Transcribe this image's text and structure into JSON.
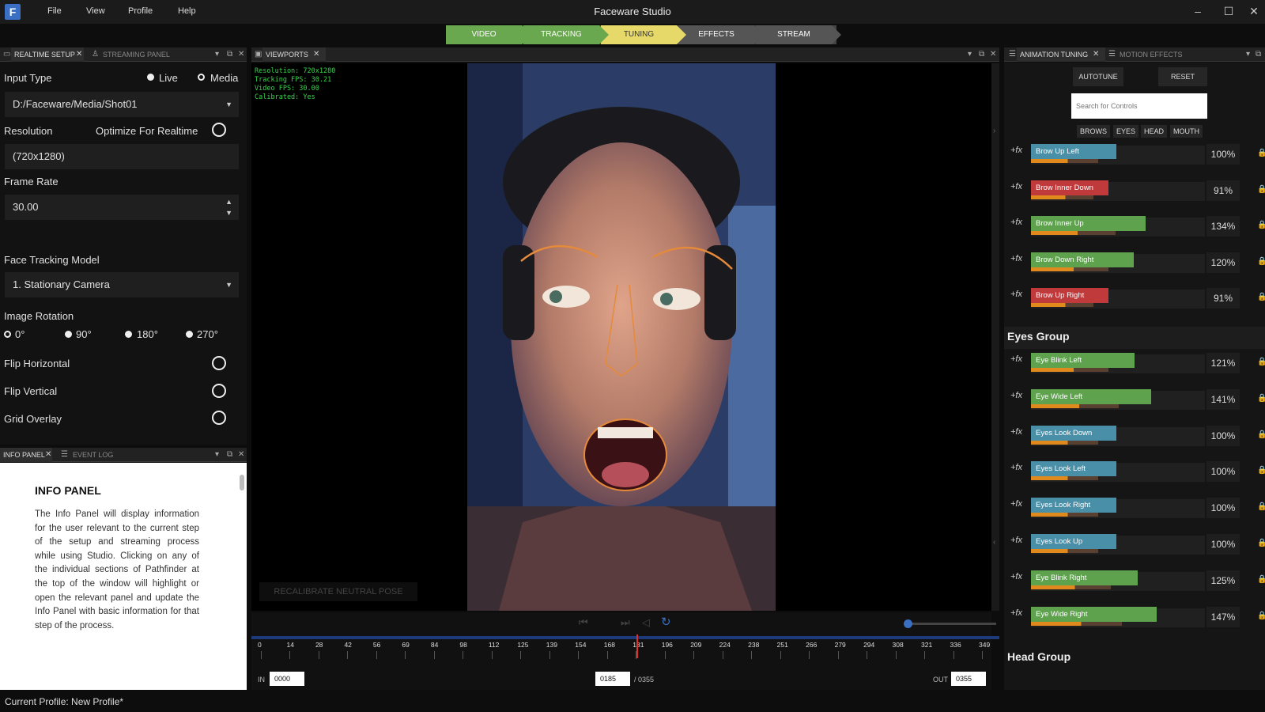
{
  "app": {
    "title": "Faceware Studio"
  },
  "menu": [
    "File",
    "View",
    "Profile",
    "Help"
  ],
  "window_controls": [
    "–",
    "☐",
    "✕"
  ],
  "pipeline": {
    "steps": [
      {
        "label": "VIDEO",
        "color": "#6aa84f"
      },
      {
        "label": "TRACKING",
        "color": "#6aa84f"
      },
      {
        "label": "TUNING",
        "color": "#e6d96a"
      },
      {
        "label": "EFFECTS",
        "color": "#555555"
      },
      {
        "label": "STREAM",
        "color": "#555555"
      }
    ]
  },
  "left_tabs": {
    "active": "REALTIME SETUP",
    "inactive": "STREAMING PANEL"
  },
  "realtime": {
    "input_type_label": "Input Type",
    "live_label": "Live",
    "media_label": "Media",
    "media_path": "D:/Faceware/Media/Shot01",
    "resolution_label": "Resolution",
    "optimize_label": "Optimize For Realtime",
    "resolution_value": "(720x1280)",
    "frame_rate_label": "Frame Rate",
    "frame_rate_value": "30.00",
    "tracking_model_label": "Face Tracking Model",
    "tracking_model_value": "1. Stationary Camera",
    "rotation_label": "Image Rotation",
    "rotations": [
      "0°",
      "90°",
      "180°",
      "270°"
    ],
    "flip_h_label": "Flip Horizontal",
    "flip_v_label": "Flip Vertical",
    "grid_label": "Grid Overlay"
  },
  "info_tabs": {
    "active": "INFO PANEL",
    "inactive": "EVENT LOG"
  },
  "info": {
    "title": "INFO PANEL",
    "body": "The Info Panel will display information for the user relevant to the current step of the setup and streaming process while using Studio. Clicking on any of the individual sections of Pathfinder at the top of the window will highlight or open the relevant panel and update the Info Panel with basic information for that step of the process."
  },
  "viewport": {
    "tab": "VIEWPORTS",
    "stats": [
      "Resolution: 720x1280",
      "Tracking FPS: 30.21",
      "Video FPS: 30.00",
      "Calibrated: Yes"
    ],
    "recalibrate_label": "RECALIBRATE NEUTRAL POSE"
  },
  "timeline": {
    "ticks": [
      "0",
      "14",
      "28",
      "42",
      "56",
      "69",
      "84",
      "98",
      "112",
      "125",
      "139",
      "154",
      "168",
      "181",
      "196",
      "209",
      "224",
      "238",
      "251",
      "266",
      "279",
      "294",
      "308",
      "321",
      "336",
      "349"
    ],
    "in_label": "IN",
    "in_value": "0000",
    "current": "0185",
    "total": "/ 0355",
    "out_label": "OUT",
    "out_value": "0355",
    "playhead_fraction": 0.521
  },
  "right_tabs": {
    "active": "ANIMATION TUNING",
    "inactive": "MOTION EFFECTS"
  },
  "tuning": {
    "autotune_label": "AUTOTUNE",
    "reset_label": "RESET",
    "search_placeholder": "Search for Controls",
    "groups": [
      "BROWS",
      "EYES",
      "HEAD",
      "MOUTH"
    ],
    "fx_label": "+fx",
    "brows": [
      {
        "name": "Brow Up Left",
        "pct": "100%",
        "color": "#4a8fa8"
      },
      {
        "name": "Brow Inner Down",
        "pct": "91%",
        "color": "#c0393b"
      },
      {
        "name": "Brow Inner Up",
        "pct": "134%",
        "color": "#5ea24e"
      },
      {
        "name": "Brow Down Right",
        "pct": "120%",
        "color": "#5ea24e"
      },
      {
        "name": "Brow Up Right",
        "pct": "91%",
        "color": "#c0393b"
      }
    ],
    "eyes_title": "Eyes Group",
    "eyes": [
      {
        "name": "Eye Blink Left",
        "pct": "121%",
        "color": "#5ea24e"
      },
      {
        "name": "Eye Wide Left",
        "pct": "141%",
        "color": "#5ea24e"
      },
      {
        "name": "Eyes Look Down",
        "pct": "100%",
        "color": "#4a8fa8"
      },
      {
        "name": "Eyes Look Left",
        "pct": "100%",
        "color": "#4a8fa8"
      },
      {
        "name": "Eyes Look Right",
        "pct": "100%",
        "color": "#4a8fa8"
      },
      {
        "name": "Eyes Look Up",
        "pct": "100%",
        "color": "#4a8fa8"
      },
      {
        "name": "Eye Blink Right",
        "pct": "125%",
        "color": "#5ea24e"
      },
      {
        "name": "Eye Wide Right",
        "pct": "147%",
        "color": "#5ea24e"
      }
    ],
    "head_title": "Head Group"
  },
  "status": {
    "profile": "Current Profile: New Profile*"
  }
}
